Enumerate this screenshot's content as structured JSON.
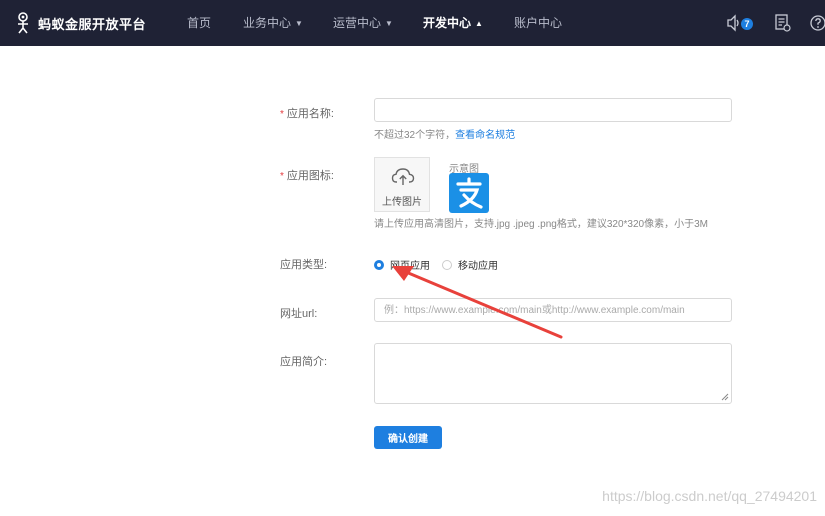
{
  "brand": {
    "name": "蚂蚁金服开放平台"
  },
  "nav": {
    "items": [
      {
        "label": "首页",
        "dropdown": false,
        "active": false
      },
      {
        "label": "业务中心",
        "dropdown": true,
        "active": false
      },
      {
        "label": "运营中心",
        "dropdown": true,
        "active": false
      },
      {
        "label": "开发中心",
        "dropdown": true,
        "active": true
      },
      {
        "label": "账户中心",
        "dropdown": false,
        "active": false
      }
    ],
    "notification_count": "7",
    "icons": [
      "speaker-icon",
      "document-settings-icon",
      "help-icon"
    ]
  },
  "form": {
    "app_name": {
      "label": "应用名称:",
      "value": "",
      "hint": "不超过32个字符，",
      "hint_link": "查看命名规范"
    },
    "app_icon": {
      "label": "应用图标:",
      "upload_label": "上传图片",
      "sample_label": "示意图",
      "hint": "请上传应用高清图片，支持.jpg .jpeg .png格式，建议320*320像素，小于3M"
    },
    "app_type": {
      "label": "应用类型:",
      "options": [
        {
          "label": "网页应用",
          "checked": true
        },
        {
          "label": "移动应用",
          "checked": false
        }
      ]
    },
    "url": {
      "label": "网址url:",
      "placeholder": "例：https://www.example.com/main或http://www.example.com/main"
    },
    "intro": {
      "label": "应用简介:",
      "value": ""
    },
    "submit_label": "确认创建"
  },
  "watermark": "https://blog.csdn.net/qq_27494201",
  "colors": {
    "nav_bg": "#1f2235",
    "accent": "#1e7fe0",
    "required": "#e4393c",
    "annotation_arrow": "#e8413b"
  }
}
